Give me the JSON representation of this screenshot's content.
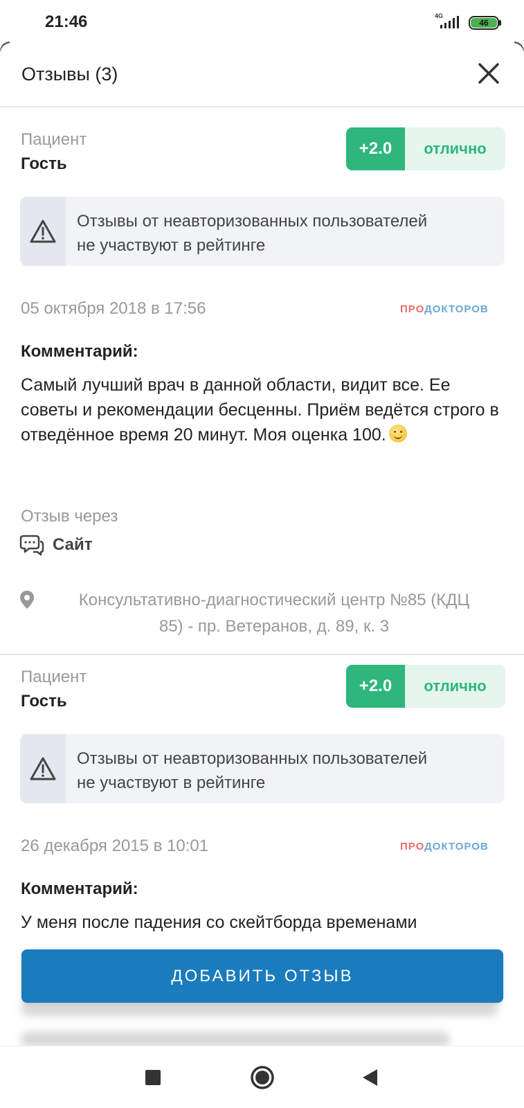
{
  "status_bar": {
    "time": "21:46",
    "network": "4G",
    "battery_level": "46"
  },
  "sheet": {
    "title": "Отзывы (3)"
  },
  "reviews": [
    {
      "patient_label": "Пациент",
      "patient_name": "Гость",
      "score": "+2.0",
      "score_word": "отлично",
      "notice_line1": "Отзывы от неавторизованных пользователей",
      "notice_line2": "не участвуют в рейтинге",
      "date": "05 октября 2018 в 17:56",
      "source_pro": "ПРО",
      "source_doc": "ДОКТОРОВ",
      "comment_label": "Комментарий:",
      "comment_text": "Самый лучший врач в данной области, видит все. Ее советы и рекомендации бесценны. Приём ведётся строго в отведённое время 20 минут. Моя оценка 100.",
      "via_label": "Отзыв через",
      "via_value": "Сайт",
      "location_line1": "Консультативно-диагностический центр №85 (КДЦ",
      "location_line2": "85) - пр. Ветеранов, д. 89, к. 3"
    },
    {
      "patient_label": "Пациент",
      "patient_name": "Гость",
      "score": "+2.0",
      "score_word": "отлично",
      "notice_line1": "Отзывы от неавторизованных пользователей",
      "notice_line2": "не участвуют в рейтинге",
      "date": "26 декабря 2015 в 10:01",
      "source_pro": "ПРО",
      "source_doc": "ДОКТОРОВ",
      "comment_label": "Комментарий:",
      "comment_text": "У меня после падения со скейтборда временами"
    }
  ],
  "actions": {
    "add_review_label": "ДОБАВИТЬ ОТЗЫВ"
  },
  "colors": {
    "accent": "#1a7bbd",
    "rating_green": "#2eb67d",
    "rating_bg": "#e4f6ee"
  },
  "icons": {
    "close": "close-icon",
    "warning": "warning-icon",
    "chat": "chat-bubbles-icon",
    "location": "location-pin-icon",
    "nav_recent": "square-icon",
    "nav_home": "circle-icon",
    "nav_back": "triangle-back-icon"
  }
}
